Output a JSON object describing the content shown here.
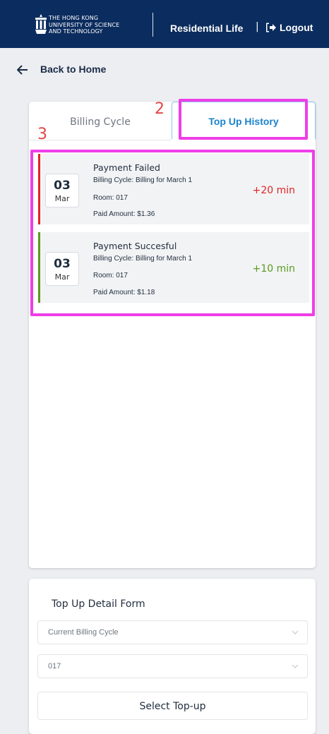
{
  "header": {
    "logo_lines": [
      "THE HONG KONG",
      "UNIVERSITY OF SCIENCE",
      "AND TECHNOLOGY"
    ],
    "title": "Residential Life",
    "separator": "|",
    "logout_label": "Logout",
    "background": "#0b2c5e"
  },
  "nav": {
    "back_label": "Back to Home"
  },
  "tabs": {
    "billing_cycle": "Billing Cycle",
    "top_up_history": "Top Up History",
    "active": "Top Up History"
  },
  "annotations": {
    "tab_marker": "2",
    "list_marker": "3",
    "highlight_color": "#ee3ee8"
  },
  "history": [
    {
      "day": "03",
      "month": "Mar",
      "status": "Payment Failed",
      "billing_cycle": "Billing Cycle: Billing for March 1",
      "room": "Room: 017",
      "paid_amount": "Paid Amount: $1.36",
      "minutes": "+20 min",
      "color": "#e02424"
    },
    {
      "day": "03",
      "month": "Mar",
      "status": "Payment Succesful",
      "billing_cycle": "Billing Cycle: Billing for March 1",
      "room": "Room: 017",
      "paid_amount": "Paid Amount: $1.18",
      "minutes": "+10 min",
      "color": "#5a9a1f"
    }
  ],
  "form": {
    "title": "Top Up Detail Form",
    "billing_cycle_select": "Current Billing Cycle",
    "room_select": "017",
    "select_topup_label": "Select Top-up"
  }
}
